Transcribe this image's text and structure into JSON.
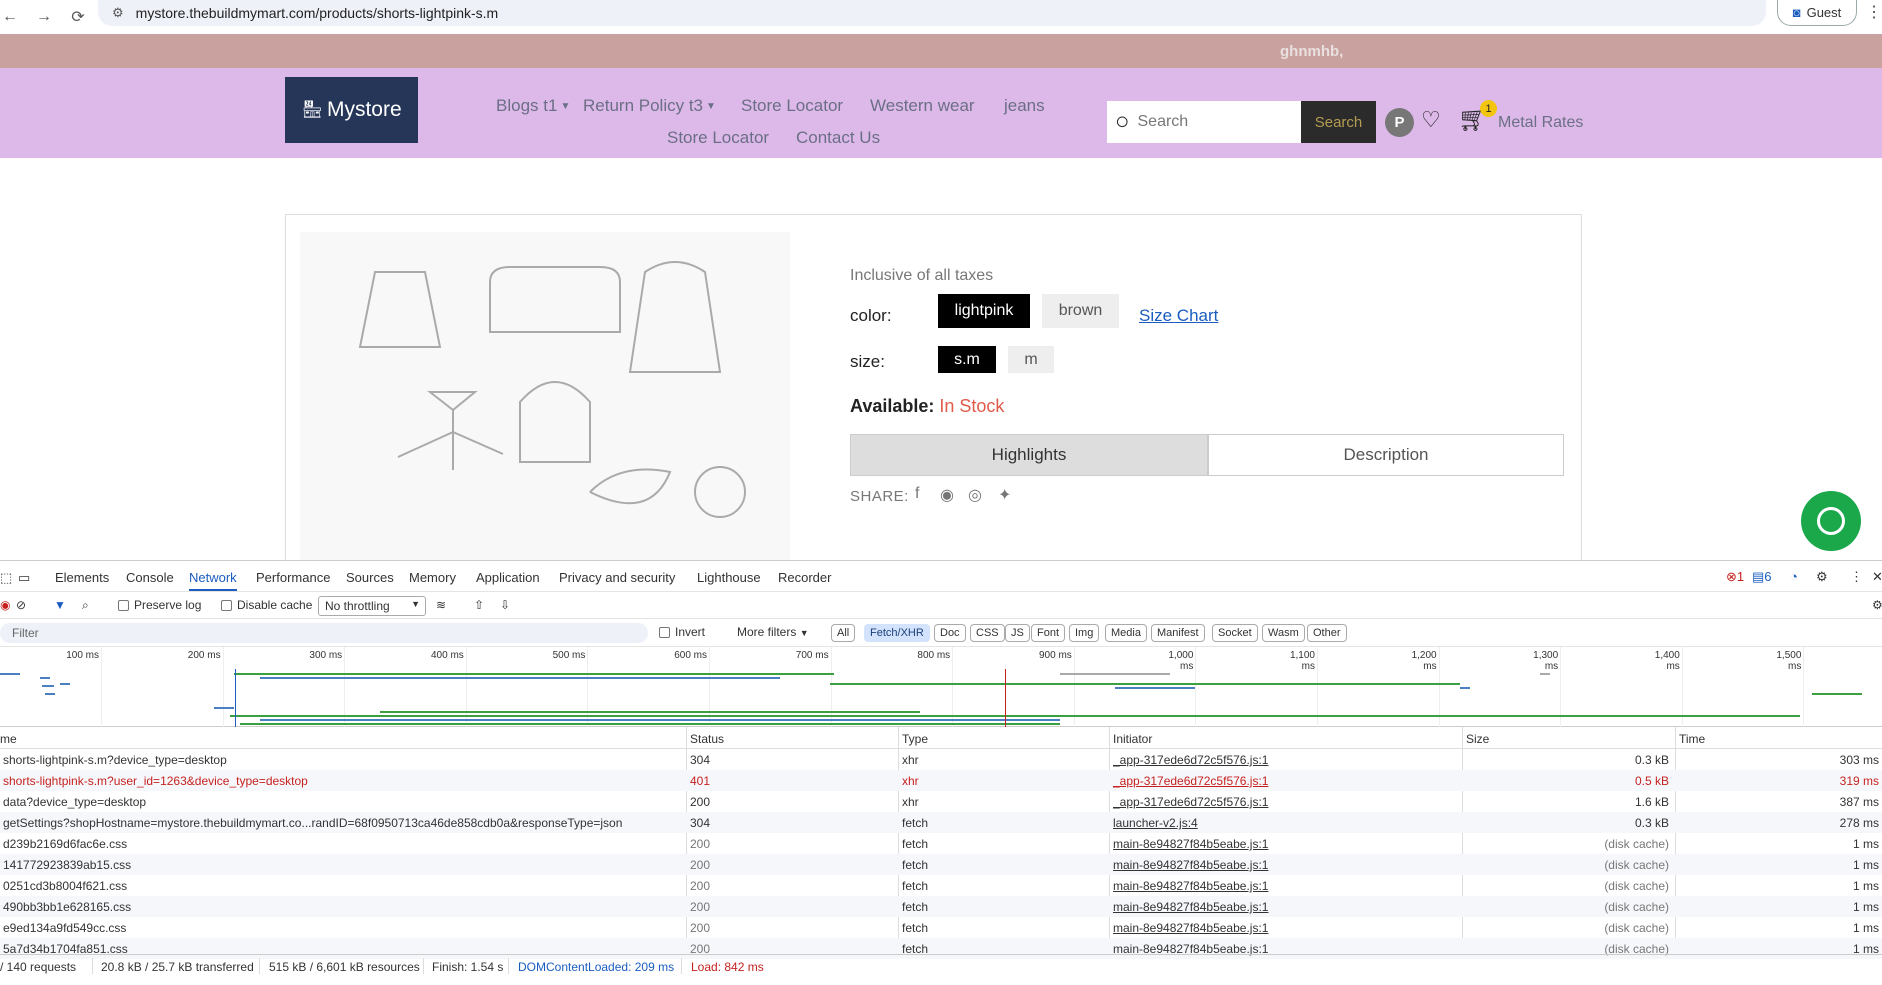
{
  "browser": {
    "back": "←",
    "forward": "→",
    "reload": "⟳",
    "url": "mystore.thebuildmymart.com/products/shorts-lightpink-s.m",
    "guest_label": "Guest"
  },
  "announcement": "ghnmhb,",
  "header": {
    "logo_text": "Mystore",
    "menu": {
      "blogs": "Blogs t1",
      "return_policy": "Return Policy t3",
      "store_locator_1": "Store Locator",
      "western_wear": "Western wear",
      "jeans": "jeans",
      "store_locator_2": "Store Locator",
      "contact": "Contact Us"
    },
    "search_placeholder": "Search",
    "search_button": "Search",
    "avatar_letter": "P",
    "cart_count": "1",
    "metal_rates": "Metal Rates"
  },
  "product": {
    "taxes": "Inclusive of all taxes",
    "color_label": "color:",
    "colors": [
      "lightpink",
      "brown"
    ],
    "size_chart": "Size Chart",
    "size_label": "size:",
    "sizes": [
      "s.m",
      "m"
    ],
    "available_label": "Available:",
    "available_value": "In Stock",
    "tabs": [
      "Highlights",
      "Description"
    ],
    "share_label": "SHARE:"
  },
  "devtools": {
    "tabs": [
      "Elements",
      "Console",
      "Network",
      "Performance",
      "Sources",
      "Memory",
      "Application",
      "Privacy and security",
      "Lighthouse",
      "Recorder"
    ],
    "active_tab": "Network",
    "error_count": "1",
    "message_count": "6",
    "toolbar": {
      "preserve_log": "Preserve log",
      "disable_cache": "Disable cache",
      "throttling": "No throttling"
    },
    "filter": {
      "placeholder": "Filter",
      "invert": "Invert",
      "more_filters": "More filters",
      "types": [
        "All",
        "Fetch/XHR",
        "Doc",
        "CSS",
        "JS",
        "Font",
        "Img",
        "Media",
        "Manifest",
        "Socket",
        "Wasm",
        "Other"
      ],
      "active_type": "Fetch/XHR"
    },
    "timeline_ticks": [
      "100 ms",
      "200 ms",
      "300 ms",
      "400 ms",
      "500 ms",
      "600 ms",
      "700 ms",
      "800 ms",
      "900 ms",
      "1,000 ms",
      "1,100 ms",
      "1,200 ms",
      "1,300 ms",
      "1,400 ms",
      "1,500 ms"
    ],
    "columns": [
      "me",
      "Status",
      "Type",
      "Initiator",
      "Size",
      "Time"
    ],
    "rows": [
      {
        "name": "shorts-lightpink-s.m?device_type=desktop",
        "status": "304",
        "type": "xhr",
        "initiator": "_app-317ede6d72c5f576.js:1",
        "size": "0.3 kB",
        "time": "303 ms",
        "error": false
      },
      {
        "name": "shorts-lightpink-s.m?user_id=1263&device_type=desktop",
        "status": "401",
        "type": "xhr",
        "initiator": "_app-317ede6d72c5f576.js:1",
        "size": "0.5 kB",
        "time": "319 ms",
        "error": true
      },
      {
        "name": "data?device_type=desktop",
        "status": "200",
        "type": "xhr",
        "initiator": "_app-317ede6d72c5f576.js:1",
        "size": "1.6 kB",
        "time": "387 ms",
        "error": false
      },
      {
        "name": "getSettings?shopHostname=mystore.thebuildmymart.co...randID=68f0950713ca46de858cdb0a&responseType=json",
        "status": "304",
        "type": "fetch",
        "initiator": "launcher-v2.js:4",
        "size": "0.3 kB",
        "time": "278 ms",
        "error": false
      },
      {
        "name": "d239b2169d6fac6e.css",
        "status": "200",
        "type": "fetch",
        "initiator": "main-8e94827f84b5eabe.js:1",
        "size": "(disk cache)",
        "time": "1 ms",
        "error": false
      },
      {
        "name": "141772923839ab15.css",
        "status": "200",
        "type": "fetch",
        "initiator": "main-8e94827f84b5eabe.js:1",
        "size": "(disk cache)",
        "time": "1 ms",
        "error": false
      },
      {
        "name": "0251cd3b8004f621.css",
        "status": "200",
        "type": "fetch",
        "initiator": "main-8e94827f84b5eabe.js:1",
        "size": "(disk cache)",
        "time": "1 ms",
        "error": false
      },
      {
        "name": "490bb3bb1e628165.css",
        "status": "200",
        "type": "fetch",
        "initiator": "main-8e94827f84b5eabe.js:1",
        "size": "(disk cache)",
        "time": "1 ms",
        "error": false
      },
      {
        "name": "e9ed134a9fd549cc.css",
        "status": "200",
        "type": "fetch",
        "initiator": "main-8e94827f84b5eabe.js:1",
        "size": "(disk cache)",
        "time": "1 ms",
        "error": false
      },
      {
        "name": "5a7d34b1704fa851.css",
        "status": "200",
        "type": "fetch",
        "initiator": "main-8e94827f84b5eabe.js:1",
        "size": "(disk cache)",
        "time": "1 ms",
        "error": false
      }
    ],
    "status_bar": {
      "requests": "/ 140 requests",
      "transferred": "20.8 kB / 25.7 kB transferred",
      "resources": "515 kB / 6,601 kB resources",
      "finish": "Finish: 1.54 s",
      "dom_loaded": "DOMContentLoaded: 209 ms",
      "load": "Load: 842 ms"
    }
  },
  "colors": {
    "announcement_bg": "#c9a19e",
    "header_bg": "#ddb9ea",
    "logo_bg": "#253659",
    "stock_red": "#e05a4a",
    "chat_green": "#1aa84a",
    "devtools_accent": "#1a5dbf"
  }
}
